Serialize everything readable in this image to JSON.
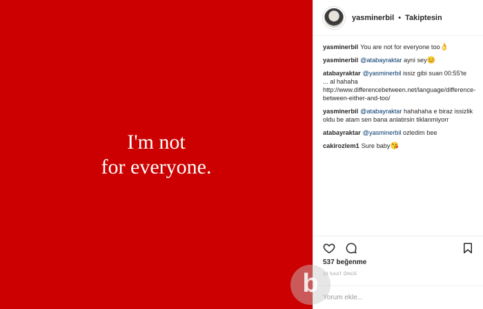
{
  "post": {
    "image_text": "I'm not\nfor everyone."
  },
  "header": {
    "username": "yasminerbil",
    "separator": "•",
    "follow_status": "Takiptesin"
  },
  "comments": [
    {
      "user": "yasminerbil",
      "mention": "",
      "text": "You are not for everyone too",
      "emoji": "👌"
    },
    {
      "user": "yasminerbil",
      "mention": "@atabayraktar",
      "text": "ayni sey",
      "emoji": "😊"
    },
    {
      "user": "atabayraktar",
      "mention": "@yasminerbil",
      "text": "issiz gibi suan 00:55'te ... al hahaha http://www.differencebetween.net/language/difference-between-either-and-too/",
      "emoji": ""
    },
    {
      "user": "yasminerbil",
      "mention": "@atabayraktar",
      "text": "hahahaha e biraz issizlik oldu be atam sen bana anlatirsin tiklanmiyorr",
      "emoji": ""
    },
    {
      "user": "atabayraktar",
      "mention": "@yasminerbil",
      "text": "ozledim bee",
      "emoji": ""
    },
    {
      "user": "cakirozlem1",
      "mention": "",
      "text": "Sure baby",
      "emoji": "😘"
    }
  ],
  "actions": {
    "icons": [
      "heart-icon",
      "comment-icon",
      "bookmark-icon"
    ]
  },
  "likes": "537 beğenme",
  "time": "10 SAAT ÖNCE",
  "add_comment": {
    "placeholder": "Yorum ekle..."
  },
  "watermark": {
    "letter": "b"
  },
  "colors": {
    "post_bg": "#cc0000",
    "mention": "#003569",
    "text": "#262626",
    "muted": "#999999"
  }
}
